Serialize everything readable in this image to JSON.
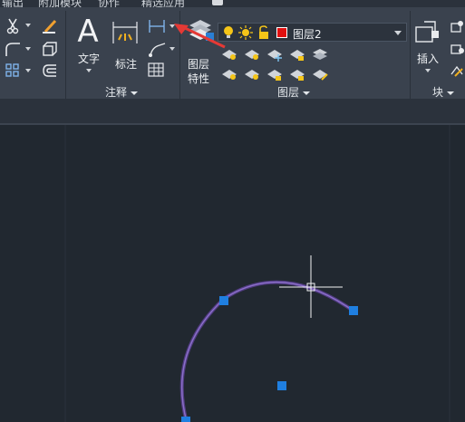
{
  "menu": {
    "items": [
      "输出",
      "附加模块",
      "协作",
      "精选应用"
    ]
  },
  "ribbon": {
    "annotation_panel": {
      "text_label": "文字",
      "dimension_label": "标注",
      "group_label": "注释"
    },
    "layers_panel": {
      "properties_label_line1": "图层",
      "properties_label_line2": "特性",
      "current_layer": "图层2",
      "current_layer_color": "#e01010",
      "group_label": "图层"
    },
    "block_panel": {
      "insert_label": "插入",
      "group_label": "块"
    }
  },
  "colors": {
    "canvas": "#212830",
    "ribbon": "#3a424e",
    "arc": "#6f4fa8",
    "grip": "#1f7fe0",
    "annotation_arrow": "#e53935"
  },
  "icons": [
    "scissors-icon",
    "brush-icon",
    "fillet-icon",
    "box-icon",
    "array-icon",
    "offset-icon",
    "text-icon",
    "dimension-icon",
    "linear-dimension-icon",
    "leader-icon",
    "table-icon",
    "layer-properties-icon",
    "lightbulb-icon",
    "sun-icon",
    "lock-icon",
    "insert-block-icon",
    "crosshair-cursor",
    "red-arrow-annotation"
  ]
}
